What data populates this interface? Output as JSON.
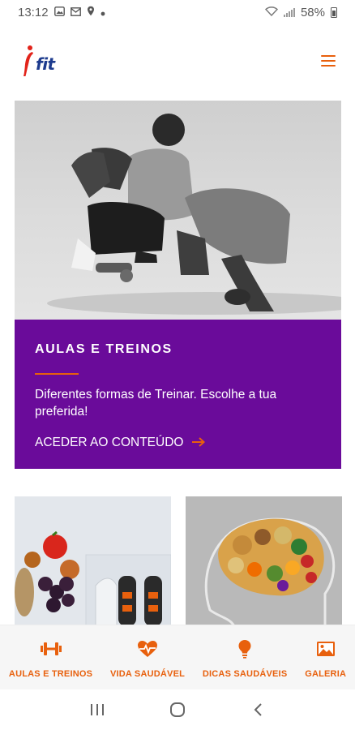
{
  "status_bar": {
    "time": "13:12",
    "battery": "58%"
  },
  "header": {
    "logo_text": "fit"
  },
  "hero": {
    "title": "AULAS E TREINOS",
    "description": "Diferentes formas de Treinar. Escolhe a tua preferida!",
    "link_label": "ACEDER AO CONTEÚDO"
  },
  "bottom_nav": {
    "items": [
      {
        "label": "AULAS E TREINOS",
        "icon": "dumbbell-icon"
      },
      {
        "label": "VIDA SAUDÁVEL",
        "icon": "heartbeat-icon"
      },
      {
        "label": "DICAS SAUDÁVEIS",
        "icon": "lightbulb-icon"
      },
      {
        "label": "GALERIA",
        "icon": "image-icon"
      }
    ]
  },
  "colors": {
    "accent": "#e8600d",
    "panel": "#6a0b9a",
    "logo_blue": "#1d3b8e",
    "logo_red": "#e2231a"
  }
}
